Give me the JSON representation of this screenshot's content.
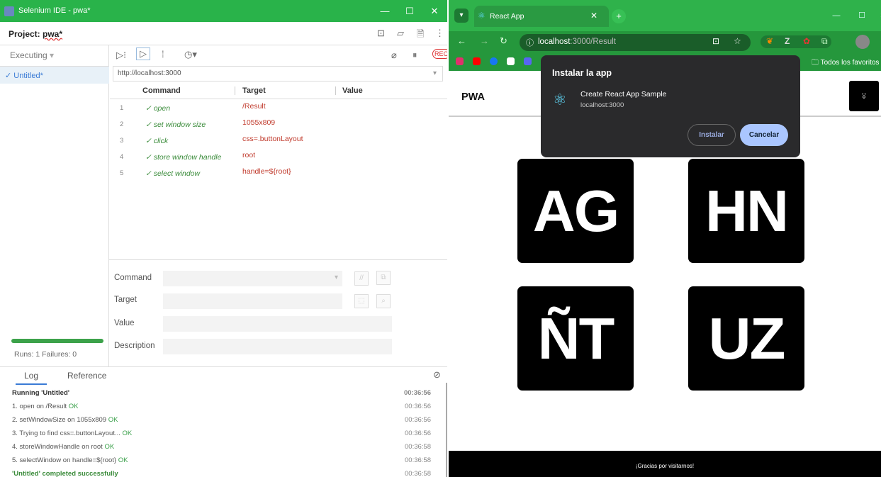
{
  "ide": {
    "window_title": "Selenium IDE - pwa*",
    "project_label": "Project: ",
    "project_name": "pwa*",
    "executing_label": "Executing",
    "test_name": "✓ Untitled*",
    "runs_text": "Runs: 1    Failures: 0",
    "base_url": "http://localhost:3000",
    "columns": {
      "command": "Command",
      "target": "Target",
      "value": "Value"
    },
    "rows": [
      {
        "n": "1",
        "command": "✓ open",
        "target": "/Result"
      },
      {
        "n": "2",
        "command": "✓ set window size",
        "target": "1055x809"
      },
      {
        "n": "3",
        "command": "✓ click",
        "target": "css=.buttonLayout"
      },
      {
        "n": "4",
        "command": "✓ store window handle",
        "target": "root"
      },
      {
        "n": "5",
        "command": "✓ select window",
        "target": "handle=${root}"
      }
    ],
    "form": {
      "command": "Command",
      "target": "Target",
      "value": "Value",
      "description": "Description"
    },
    "log_tabs": {
      "log": "Log",
      "reference": "Reference"
    },
    "log": [
      {
        "text": "Running 'Untitled'",
        "ok": "",
        "time": "00:36:56"
      },
      {
        "text": "1.  open on /Result ",
        "ok": "OK",
        "time": "00:36:56"
      },
      {
        "text": "2.  setWindowSize on 1055x809 ",
        "ok": "OK",
        "time": "00:36:56"
      },
      {
        "text": "3.  Trying to find css=.buttonLayout... ",
        "ok": "OK",
        "time": "00:36:56"
      },
      {
        "text": "4.  storeWindowHandle on root ",
        "ok": "OK",
        "time": "00:36:58"
      },
      {
        "text": "5.  selectWindow on handle=${root} ",
        "ok": "OK",
        "time": "00:36:58"
      },
      {
        "text": "'Untitled' completed successfully",
        "ok": "",
        "time": "00:36:58"
      }
    ]
  },
  "browser": {
    "tab_title": "React App",
    "url_host": "localhost",
    "url_path": ":3000/Result",
    "favorites": "Todos los favoritos",
    "brand": "PWA",
    "tiles": [
      "AG",
      "HN",
      "ÑT",
      "UZ"
    ],
    "footer": "¡Gracias por visitarnos!",
    "install": {
      "heading": "Instalar la app",
      "app_name": "Create React App Sample",
      "host": "localhost:3000",
      "install_btn": "Instalar",
      "cancel_btn": "Cancelar"
    }
  },
  "icons": {
    "react": "react-logo-icon",
    "add_user": "add-user-icon"
  },
  "colors": {
    "window_green": "#29b34a",
    "react_blue": "#61dafb",
    "ok_green": "#3aa04a",
    "popup_bg": "#2a2a2c",
    "cancel_blue": "#aac6ff"
  }
}
